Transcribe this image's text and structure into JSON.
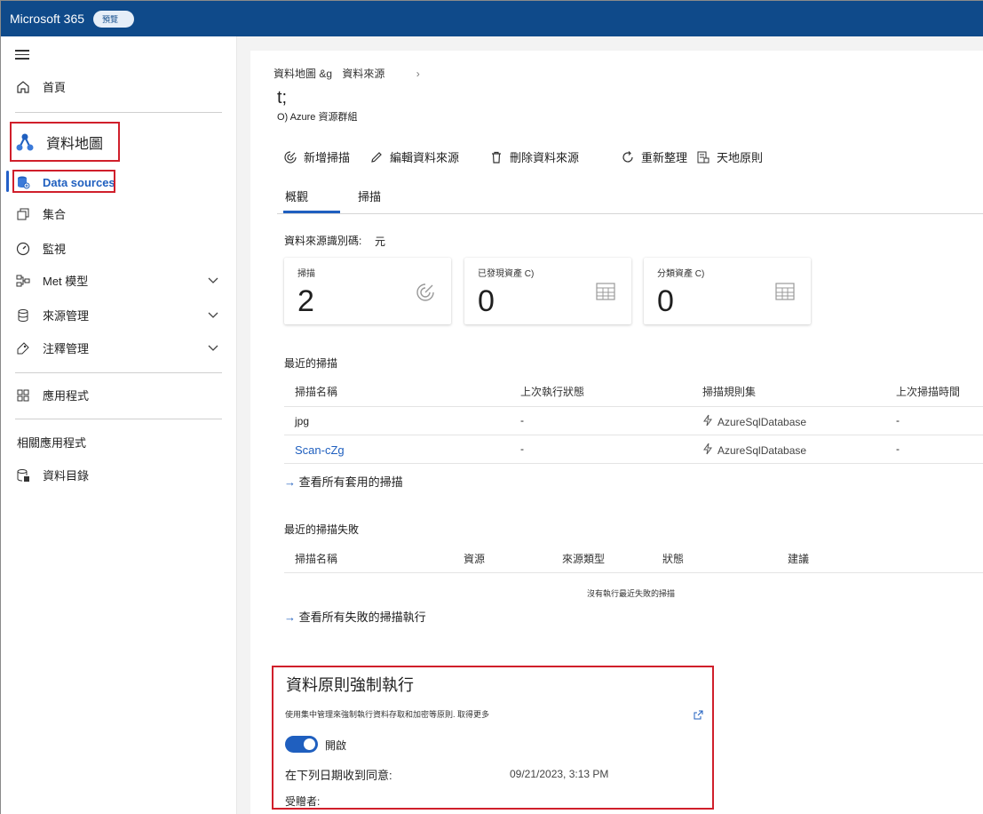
{
  "topbar": {
    "brand": "Microsoft 365",
    "badge": "預覽"
  },
  "sidebar": {
    "home": "首頁",
    "data_map": "資料地圖",
    "data_sources": "Data sources",
    "collections": "集合",
    "monitoring": "監視",
    "meta_model": "Met 模型",
    "source_management": "來源管理",
    "annotation_management": "注釋管理",
    "applications": "應用程式",
    "related_apps": "相關應用程式",
    "data_catalog": "資料目錄"
  },
  "breadcrumb": {
    "part1": "資料地圖 &g",
    "part2": "資料來源",
    "chevron": "›"
  },
  "page": {
    "title": "t;",
    "subtitle": "O) Azure 資源群組"
  },
  "commands": {
    "new_scan": "新增掃描",
    "edit_source": "編輯資料來源",
    "delete_source": "刪除資料來源",
    "refresh": "重新整理",
    "policy": "天地原則"
  },
  "tabs": {
    "overview": "概觀",
    "scan": "掃描"
  },
  "source_id": {
    "label": "資料來源識別碼:",
    "value": "元"
  },
  "cards": [
    {
      "label": "掃描",
      "value": "2",
      "icon": "scan-icon"
    },
    {
      "label": "已發現資產 C)",
      "value": "0",
      "icon": "table-icon"
    },
    {
      "label": "分類資產 C)",
      "value": "0",
      "icon": "table-icon"
    }
  ],
  "recent_scans": {
    "title": "最近的掃描",
    "headers": [
      "掃描名稱",
      "上次執行狀態",
      "掃描規則集",
      "上次掃描時間"
    ],
    "rows": [
      {
        "name": "jpg",
        "status": "-",
        "ruleset": "AzureSqlDatabase",
        "time": "-"
      },
      {
        "name": "Scan-cZg",
        "status": "-",
        "ruleset": "AzureSqlDatabase",
        "time": "-"
      }
    ],
    "view_all": "查看所有套用的掃描"
  },
  "recent_failures": {
    "title": "最近的掃描失敗",
    "headers": [
      "掃描名稱",
      "資源",
      "來源類型",
      "狀態",
      "建議"
    ],
    "empty": "沒有執行最近失敗的掃描",
    "view_all": "查看所有失敗的掃描執行"
  },
  "policy": {
    "title": "資料原則強制執行",
    "desc": "使用集中管理來強制執行資料存取和加密等原則. 取得更多",
    "toggle_label": "開啟",
    "consent_label": "在下列日期收到同意:",
    "consent_date": "09/21/2023, 3:13 PM",
    "grantee_label": "受贈者:"
  },
  "colors": {
    "topbar": "#0f4a8a",
    "accent": "#1f5fbf",
    "highlight": "#d01f2b"
  }
}
